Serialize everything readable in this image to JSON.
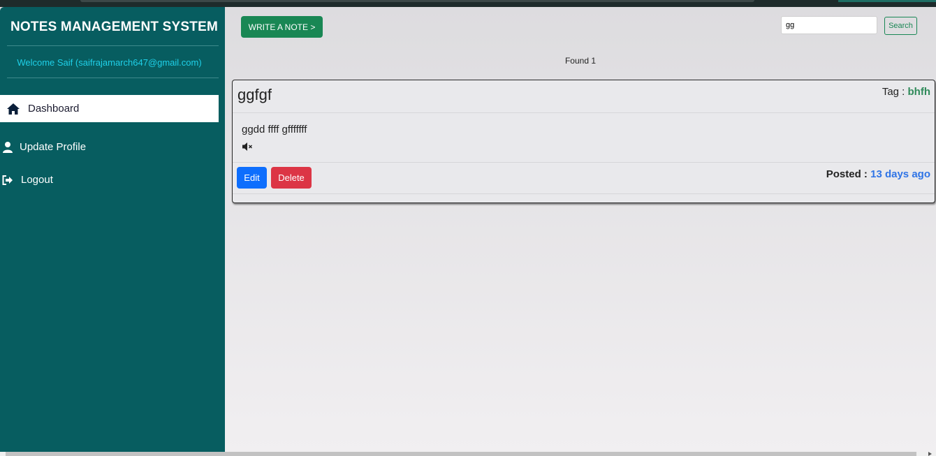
{
  "app": {
    "title": "NOTES MANAGEMENT SYSTEM",
    "welcome": "Welcome Saif (saifrajamarch647@gmail.com)"
  },
  "sidebar": {
    "items": [
      {
        "label": "Dashboard",
        "icon": "home-icon",
        "active": true
      },
      {
        "label": "Update Profile",
        "icon": "user-icon",
        "active": false
      },
      {
        "label": "Logout",
        "icon": "logout-icon",
        "active": false
      }
    ]
  },
  "toolbar": {
    "write_label": "WRITE A NOTE >",
    "search_value": "gg",
    "search_label": "Search"
  },
  "results": {
    "found_text": "Found 1"
  },
  "note": {
    "title": "ggfgf",
    "tag_label": "Tag :",
    "tag_value": "bhfh",
    "body": "ggdd ffff gfffffff",
    "media_icon": "mute-icon",
    "edit_label": "Edit",
    "delete_label": "Delete",
    "posted_label": "Posted :",
    "posted_value": "13 days ago"
  },
  "colors": {
    "sidebar_bg": "#075d60",
    "welcome_text": "#1fd0e8",
    "primary_green": "#198754",
    "edit_blue": "#0d6efd",
    "delete_red": "#dc3545",
    "tag_green": "#2f8a5a",
    "posted_blue": "#2f74e6"
  }
}
